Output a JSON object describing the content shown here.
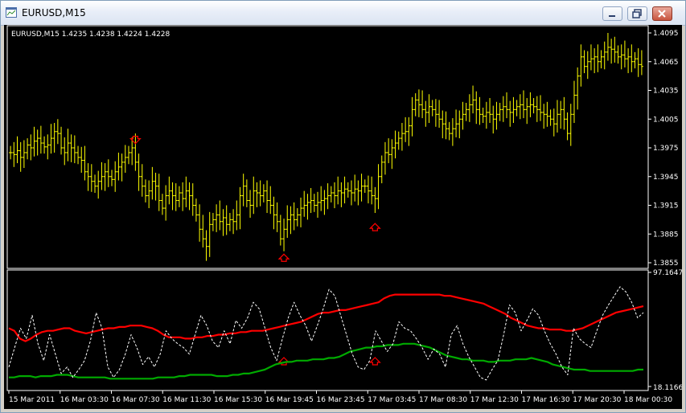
{
  "window": {
    "title": "EURUSD,M15",
    "controls": [
      "minimize",
      "restore",
      "close"
    ]
  },
  "chart_data": [
    {
      "type": "bar",
      "title": "EURUSD,M15  1.4235 1.4238 1.4224 1.4228",
      "bar_color": "#ffff00",
      "price_ticks": [
        "1.4095",
        "1.4065",
        "1.4035",
        "1.4005",
        "1.3975",
        "1.3945",
        "1.3915",
        "1.3885",
        "1.3855"
      ],
      "ylim": [
        1.3855,
        1.4095
      ],
      "arrows": [
        {
          "type": "down",
          "bar": 37,
          "color": "#ff0000"
        },
        {
          "type": "up",
          "bar": 81,
          "color": "#ff0000"
        },
        {
          "type": "up",
          "bar": 108,
          "color": "#ff0000"
        }
      ],
      "closes": [
        1.397,
        1.3968,
        1.3972,
        1.3965,
        1.397,
        1.3978,
        1.3975,
        1.3982,
        1.3985,
        1.398,
        1.3976,
        1.3978,
        1.3985,
        1.3992,
        1.399,
        1.3975,
        1.397,
        1.398,
        1.3975,
        1.397,
        1.3965,
        1.3962,
        1.395,
        1.3945,
        1.394,
        1.3935,
        1.394,
        1.3945,
        1.395,
        1.3945,
        1.3942,
        1.395,
        1.3955,
        1.396,
        1.3965,
        1.397,
        1.3975,
        1.396,
        1.3945,
        1.3935,
        1.3925,
        1.393,
        1.394,
        1.3935,
        1.392,
        1.3912,
        1.3925,
        1.393,
        1.3925,
        1.392,
        1.3928,
        1.3922,
        1.393,
        1.3925,
        1.3915,
        1.3905,
        1.389,
        1.388,
        1.3872,
        1.3895,
        1.39,
        1.3905,
        1.3898,
        1.3902,
        1.3895,
        1.39,
        1.3898,
        1.3905,
        1.3925,
        1.3935,
        1.392,
        1.3915,
        1.393,
        1.3928,
        1.3925,
        1.393,
        1.392,
        1.3915,
        1.3905,
        1.3898,
        1.388,
        1.389,
        1.39,
        1.3905,
        1.39,
        1.3905,
        1.3912,
        1.3915,
        1.3918,
        1.392,
        1.3915,
        1.3918,
        1.392,
        1.3922,
        1.3925,
        1.3928,
        1.3925,
        1.393,
        1.3928,
        1.3932,
        1.393,
        1.3928,
        1.3932,
        1.393,
        1.3935,
        1.3935,
        1.393,
        1.3925,
        1.3922,
        1.3945,
        1.396,
        1.397,
        1.3968,
        1.3975,
        1.398,
        1.3985,
        1.399,
        1.3992,
        1.3998,
        1.4015,
        1.4025,
        1.402,
        1.4015,
        1.4012,
        1.4018,
        1.4015,
        1.401,
        1.4005,
        1.4,
        1.3995,
        1.399,
        1.3995,
        1.4,
        1.4005,
        1.401,
        1.4015,
        1.402,
        1.4025,
        1.4015,
        1.401,
        1.4008,
        1.4012,
        1.401,
        1.4005,
        1.401,
        1.4015,
        1.4018,
        1.4015,
        1.4012,
        1.4015,
        1.4018,
        1.402,
        1.4015,
        1.4018,
        1.402,
        1.4018,
        1.4015,
        1.4012,
        1.401,
        1.4008,
        1.4005,
        1.4,
        1.401,
        1.4015,
        1.4005,
        1.399,
        1.401,
        1.403,
        1.405,
        1.407,
        1.406,
        1.4065,
        1.4068,
        1.407,
        1.4065,
        1.407,
        1.4075,
        1.408,
        1.4078,
        1.4075,
        1.407,
        1.4072,
        1.4068,
        1.407,
        1.4065,
        1.4068,
        1.4062,
        1.406
      ],
      "xlabels": [
        "15 Mar 2011",
        "16 Mar 03:30",
        "16 Mar 07:30",
        "16 Mar 11:30",
        "16 Mar 15:30",
        "16 Mar 19:45",
        "16 Mar 23:45",
        "17 Mar 03:45",
        "17 Mar 08:30",
        "17 Mar 12:30",
        "17 Mar 16:30",
        "17 Mar 20:30",
        "18 Mar 00:30"
      ]
    },
    {
      "type": "line",
      "ylim": [
        18.1166,
        97.1647
      ],
      "y_ticks": [
        "97.1647",
        "18.1166"
      ],
      "series": [
        {
          "color": "#ff0000",
          "style": "solid",
          "values": [
            60,
            58,
            52,
            50,
            52,
            55,
            57,
            58,
            58,
            59,
            60,
            60,
            58,
            57,
            56,
            57,
            58,
            59,
            60,
            60,
            61,
            61,
            62,
            62,
            62,
            61,
            60,
            58,
            55,
            53,
            53,
            53,
            52,
            52,
            53,
            53,
            54,
            54,
            55,
            55,
            56,
            56,
            57,
            57,
            58,
            58,
            58,
            59,
            60,
            61,
            62,
            63,
            64,
            65,
            67,
            69,
            71,
            72,
            72,
            73,
            74,
            74,
            75,
            76,
            77,
            78,
            79,
            80,
            83,
            85,
            86,
            86,
            86,
            86,
            86,
            86,
            86,
            86,
            86,
            85,
            85,
            84,
            83,
            82,
            81,
            80,
            79,
            77,
            75,
            73,
            71,
            68,
            66,
            64,
            62,
            61,
            60,
            60,
            59,
            59,
            59,
            58,
            58,
            59,
            60,
            62,
            64,
            66,
            68,
            70,
            72,
            73,
            74,
            75,
            76,
            77
          ]
        },
        {
          "color": "#00aa00",
          "style": "solid",
          "values": [
            22,
            22,
            23,
            23,
            23,
            22,
            23,
            23,
            23,
            24,
            24,
            24,
            23,
            22,
            22,
            22,
            22,
            22,
            22,
            21,
            21,
            21,
            21,
            21,
            21,
            21,
            21,
            21,
            22,
            22,
            22,
            22,
            23,
            23,
            24,
            24,
            24,
            24,
            24,
            23,
            23,
            23,
            24,
            24,
            25,
            25,
            26,
            27,
            28,
            30,
            32,
            33,
            34,
            34,
            35,
            35,
            35,
            36,
            36,
            36,
            37,
            37,
            38,
            40,
            42,
            43,
            44,
            45,
            45,
            46,
            46,
            47,
            47,
            47,
            48,
            48,
            48,
            47,
            46,
            45,
            43,
            41,
            39,
            38,
            37,
            36,
            36,
            35,
            35,
            35,
            34,
            34,
            35,
            35,
            35,
            36,
            36,
            36,
            37,
            36,
            35,
            34,
            32,
            31,
            30,
            29,
            28,
            28,
            28,
            27,
            27,
            27,
            27,
            27,
            27,
            27,
            27,
            27,
            28,
            28
          ]
        },
        {
          "color": "#ffffff",
          "style": "dashed",
          "values": [
            30,
            45,
            60,
            52,
            70,
            48,
            35,
            55,
            40,
            25,
            30,
            22,
            28,
            35,
            50,
            72,
            60,
            30,
            22,
            28,
            40,
            55,
            45,
            32,
            38,
            30,
            40,
            58,
            52,
            48,
            45,
            40,
            55,
            70,
            62,
            50,
            45,
            58,
            48,
            66,
            60,
            68,
            80,
            75,
            60,
            45,
            35,
            52,
            68,
            80,
            70,
            62,
            50,
            62,
            75,
            90,
            85,
            70,
            55,
            40,
            30,
            28,
            35,
            58,
            50,
            42,
            48,
            65,
            60,
            58,
            52,
            45,
            36,
            44,
            40,
            30,
            55,
            62,
            48,
            38,
            30,
            22,
            20,
            28,
            35,
            55,
            78,
            72,
            58,
            66,
            75,
            70,
            58,
            48,
            40,
            30,
            24,
            60,
            52,
            48,
            45,
            58,
            70,
            78,
            85,
            92,
            88,
            80,
            68,
            72
          ]
        }
      ]
    }
  ]
}
